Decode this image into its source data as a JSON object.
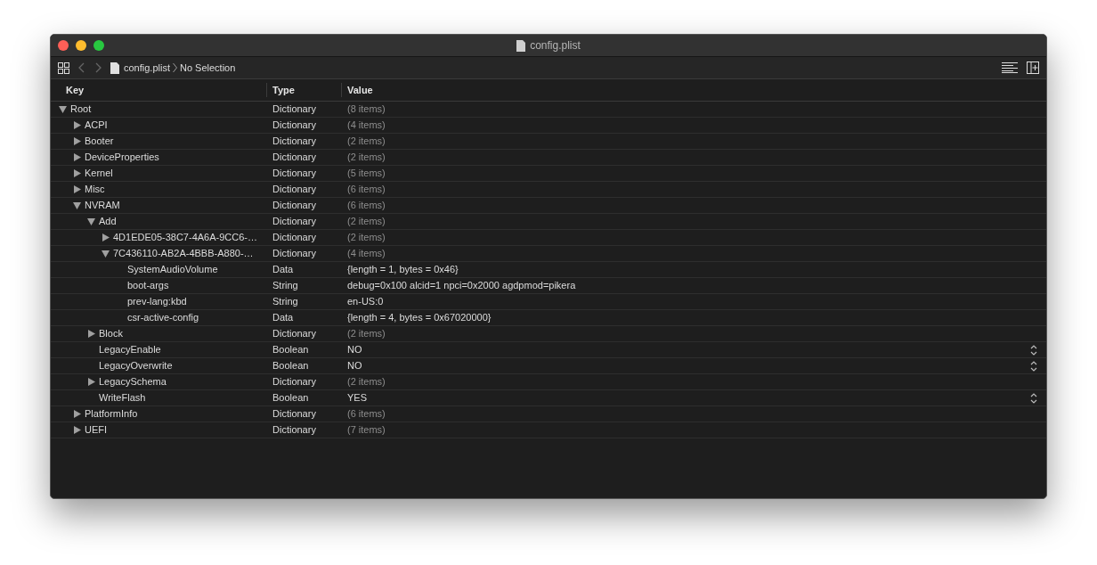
{
  "window": {
    "title": "config.plist"
  },
  "toolbar": {
    "file": "config.plist",
    "selection": "No Selection"
  },
  "table": {
    "columns": [
      "Key",
      "Type",
      "Value"
    ],
    "rows": [
      {
        "key": "Root",
        "type": "Dictionary",
        "value": "(8 items)",
        "kind": "container",
        "expanded": true,
        "children": [
          {
            "key": "ACPI",
            "type": "Dictionary",
            "value": "(4 items)",
            "kind": "container",
            "expanded": false
          },
          {
            "key": "Booter",
            "type": "Dictionary",
            "value": "(2 items)",
            "kind": "container",
            "expanded": false
          },
          {
            "key": "DeviceProperties",
            "type": "Dictionary",
            "value": "(2 items)",
            "kind": "container",
            "expanded": false
          },
          {
            "key": "Kernel",
            "type": "Dictionary",
            "value": "(5 items)",
            "kind": "container",
            "expanded": false
          },
          {
            "key": "Misc",
            "type": "Dictionary",
            "value": "(6 items)",
            "kind": "container",
            "expanded": false
          },
          {
            "key": "NVRAM",
            "type": "Dictionary",
            "value": "(6 items)",
            "kind": "container",
            "expanded": true,
            "children": [
              {
                "key": "Add",
                "type": "Dictionary",
                "value": "(2 items)",
                "kind": "container",
                "expanded": true,
                "children": [
                  {
                    "key": "4D1EDE05-38C7-4A6A-9CC6-…",
                    "type": "Dictionary",
                    "value": "(2 items)",
                    "kind": "container",
                    "expanded": false
                  },
                  {
                    "key": "7C436110-AB2A-4BBB-A880-…",
                    "type": "Dictionary",
                    "value": "(4 items)",
                    "kind": "container",
                    "expanded": true,
                    "children": [
                      {
                        "key": "SystemAudioVolume",
                        "type": "Data",
                        "value": "{length = 1, bytes = 0x46}",
                        "kind": "value"
                      },
                      {
                        "key": "boot-args",
                        "type": "String",
                        "value": "debug=0x100 alcid=1 npci=0x2000 agdpmod=pikera",
                        "kind": "value"
                      },
                      {
                        "key": "prev-lang:kbd",
                        "type": "String",
                        "value": "en-US:0",
                        "kind": "value"
                      },
                      {
                        "key": "csr-active-config",
                        "type": "Data",
                        "value": "{length = 4, bytes = 0x67020000}",
                        "kind": "value"
                      }
                    ]
                  }
                ]
              },
              {
                "key": "Block",
                "type": "Dictionary",
                "value": "(2 items)",
                "kind": "container",
                "expanded": false
              },
              {
                "key": "LegacyEnable",
                "type": "Boolean",
                "value": "NO",
                "kind": "boolean"
              },
              {
                "key": "LegacyOverwrite",
                "type": "Boolean",
                "value": "NO",
                "kind": "boolean"
              },
              {
                "key": "LegacySchema",
                "type": "Dictionary",
                "value": "(2 items)",
                "kind": "container",
                "expanded": false
              },
              {
                "key": "WriteFlash",
                "type": "Boolean",
                "value": "YES",
                "kind": "boolean"
              }
            ]
          },
          {
            "key": "PlatformInfo",
            "type": "Dictionary",
            "value": "(6 items)",
            "kind": "container",
            "expanded": false
          },
          {
            "key": "UEFI",
            "type": "Dictionary",
            "value": "(7 items)",
            "kind": "container",
            "expanded": false
          }
        ]
      }
    ]
  }
}
